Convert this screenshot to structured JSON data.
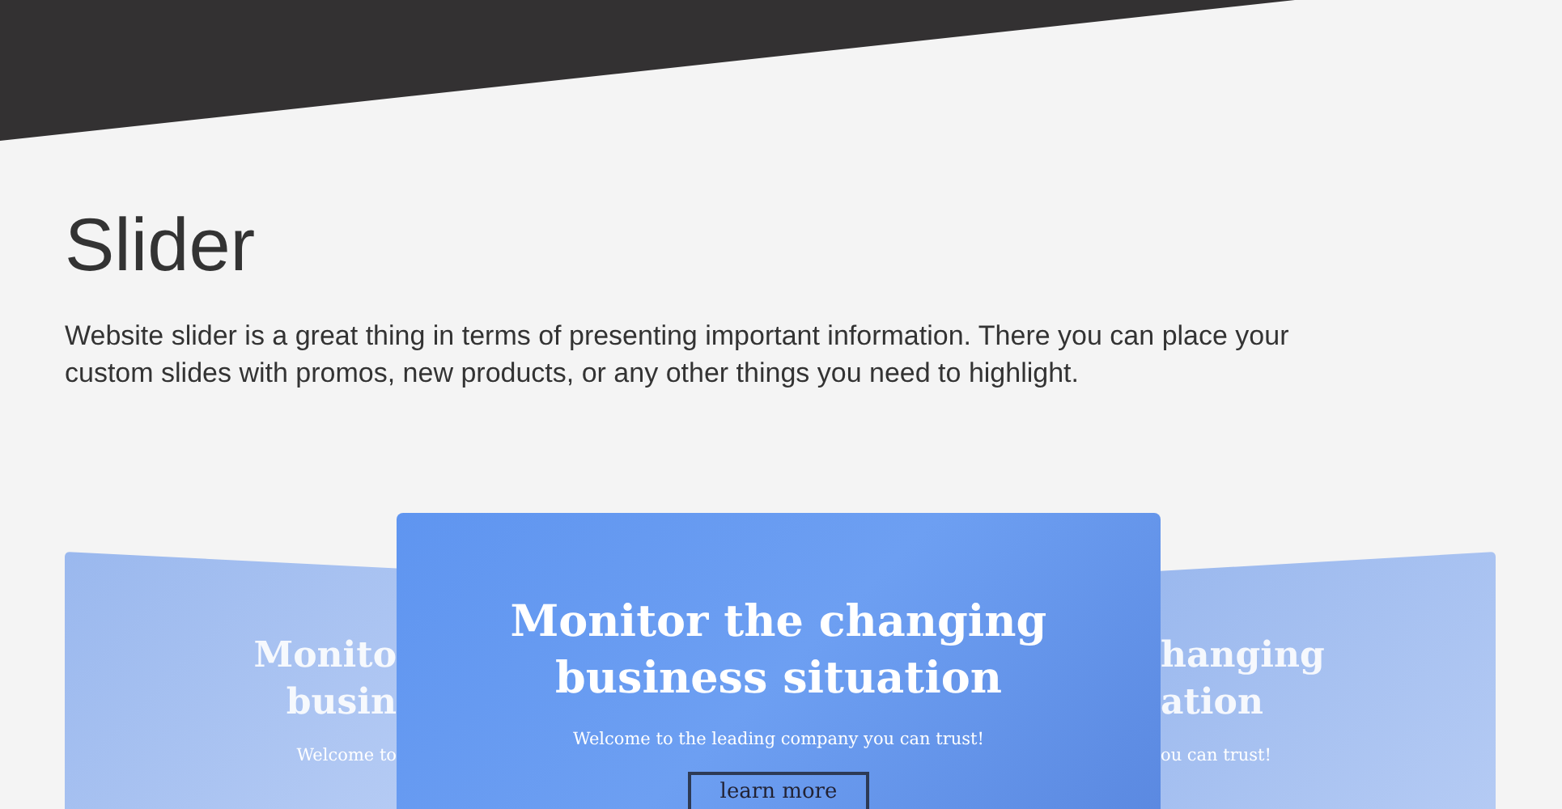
{
  "section": {
    "title": "Slider",
    "description": "Website slider is a great thing in terms of presenting important information. There you can place your custom slides with promos, new products, or any other things you need to highlight."
  },
  "slides": [
    {
      "kind": "side-left",
      "heading_lines": [
        "Monito",
        "busin"
      ],
      "subtitle": "Welcome to"
    },
    {
      "kind": "center",
      "heading_lines": [
        "Monitor the changing",
        "business situation"
      ],
      "subtitle": "Welcome to the leading company you can trust!",
      "button": "learn more"
    },
    {
      "kind": "side-right",
      "heading_lines": [
        "hanging",
        "ation"
      ],
      "subtitle": "ou can trust!"
    }
  ]
}
